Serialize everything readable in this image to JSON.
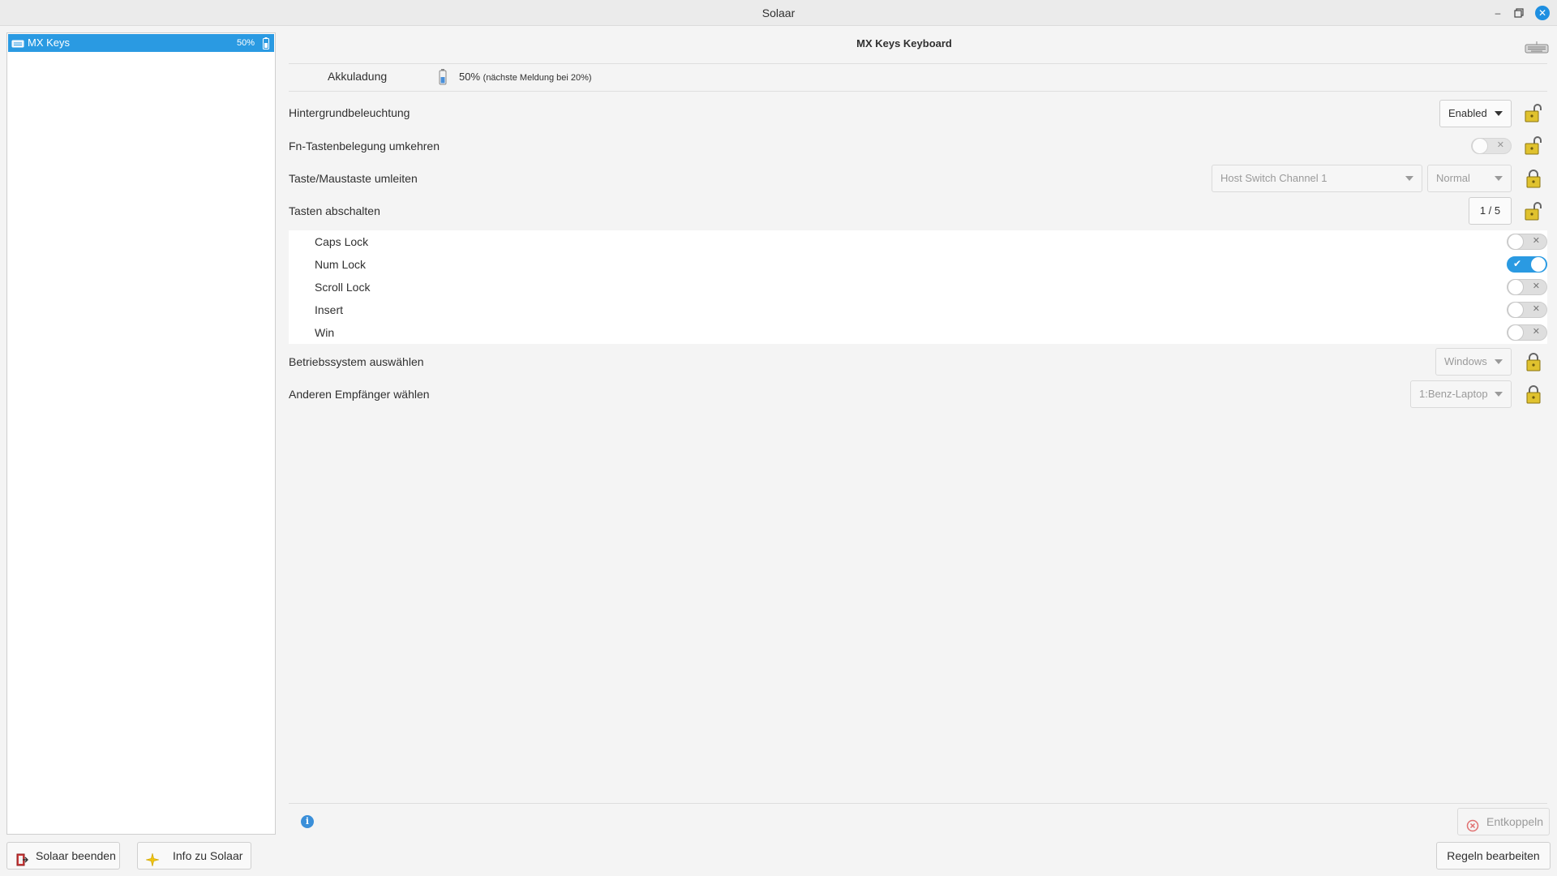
{
  "window": {
    "title": "Solaar",
    "controls": [
      "minimize",
      "maximize",
      "close"
    ]
  },
  "sidebar": {
    "devices": [
      {
        "name": "MX Keys",
        "battery": "50%",
        "icon": "keyboard-icon",
        "selected": true
      }
    ]
  },
  "device": {
    "title": "MX Keys Keyboard",
    "battery": {
      "label": "Akkuladung",
      "value": "50%",
      "note": "(nächste Meldung bei 20%)"
    },
    "settings": {
      "backlight": {
        "label": "Hintergrundbeleuchtung",
        "value": "Enabled"
      },
      "fn_swap": {
        "label": "Fn-Tastenbelegung umkehren",
        "on": false
      },
      "divert": {
        "label": "Taste/Maustaste umleiten",
        "key": "Host Switch Channel 1",
        "mode": "Normal"
      },
      "disable_keys": {
        "label": "Tasten abschalten",
        "counter": "1 / 5",
        "keys": [
          {
            "label": "Caps Lock",
            "on": false
          },
          {
            "label": "Num Lock",
            "on": true
          },
          {
            "label": "Scroll Lock",
            "on": false
          },
          {
            "label": "Insert",
            "on": false
          },
          {
            "label": "Win",
            "on": false
          }
        ]
      },
      "os": {
        "label": "Betriebssystem auswählen",
        "value": "Windows"
      },
      "receiver": {
        "label": "Anderen Empfänger wählen",
        "value": "1:Benz-Laptop"
      }
    },
    "unpair_label": "Entkoppeln",
    "info_glyph": "i"
  },
  "footer": {
    "quit_label": "Solaar beenden",
    "about_label": "Info zu Solaar",
    "rules_label": "Regeln bearbeiten"
  },
  "colors": {
    "accent": "#2a9ae2",
    "lock": "#e0c22e"
  }
}
